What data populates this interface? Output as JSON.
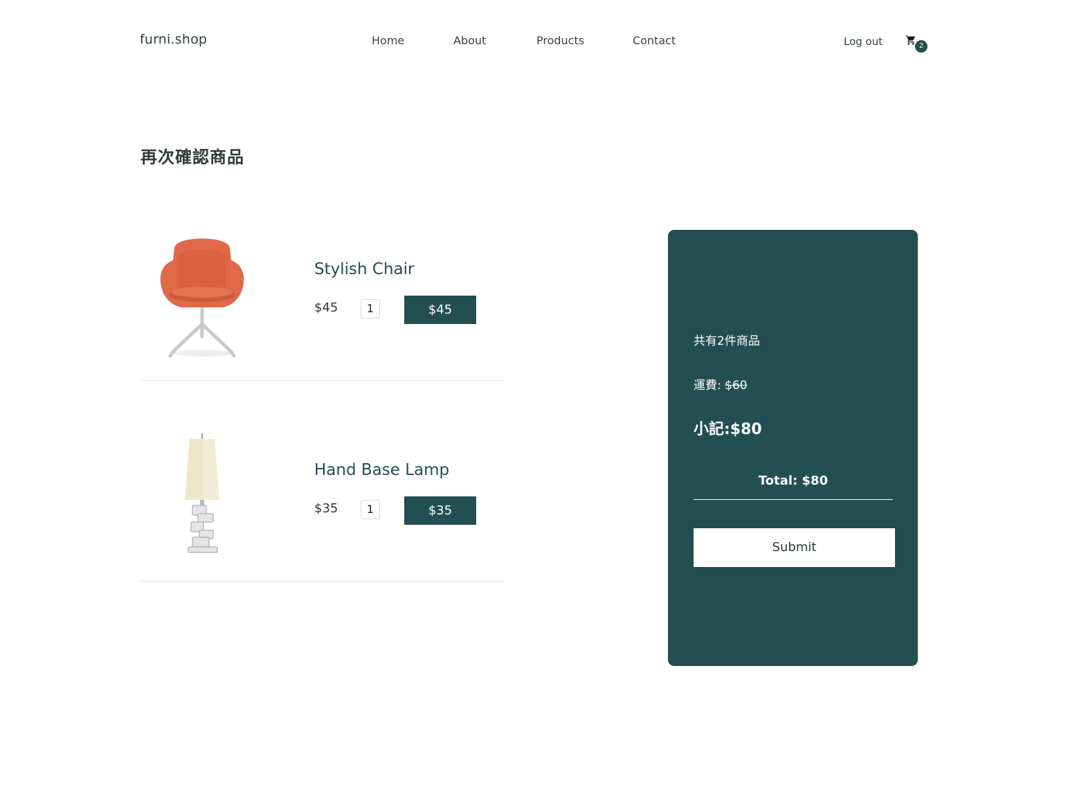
{
  "header": {
    "brand": "furni.shop",
    "nav": [
      "Home",
      "About",
      "Products",
      "Contact"
    ],
    "logout": "Log out",
    "cart_count": "2"
  },
  "page": {
    "title": "再次確認商品"
  },
  "items": [
    {
      "name": "Stylish Chair",
      "price": "$45",
      "qty": "1",
      "total": "$45",
      "image": "orange-armchair"
    },
    {
      "name": "Hand Base Lamp",
      "price": "$35",
      "qty": "1",
      "total": "$35",
      "image": "table-lamp"
    }
  ],
  "summary": {
    "count_text": "共有2件商品",
    "shipping_label": "運費: ",
    "shipping_value": "$60",
    "subtotal": "小記:$80",
    "total": "Total: $80",
    "submit": "Submit"
  },
  "colors": {
    "accent": "#244f52",
    "chair": "#e0694a"
  }
}
